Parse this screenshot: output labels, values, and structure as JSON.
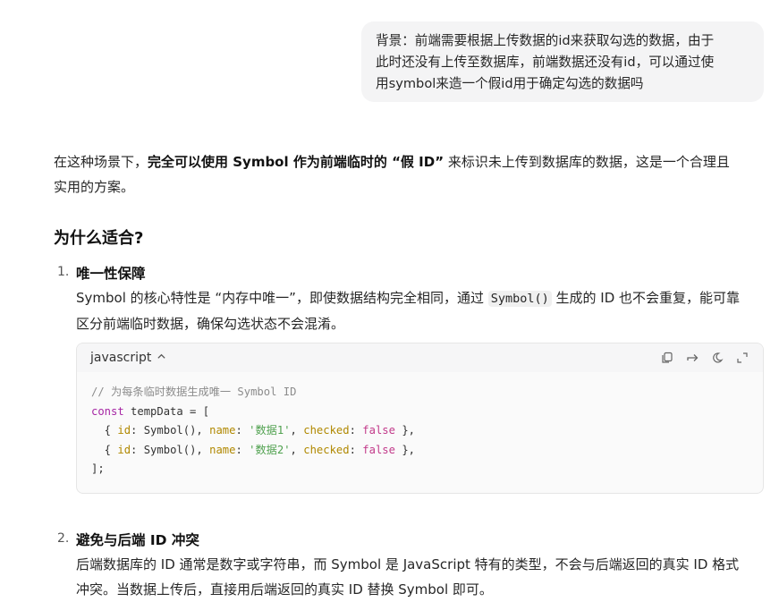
{
  "user_message": {
    "line1": "背景：前端需要根据上传数据的id来获取勾选的数据，由于",
    "line2": "此时还没有上传至数据库，前端数据还没有id，可以通过使",
    "line3": "用symbol来造一个假id用于确定勾选的数据吗"
  },
  "answer": {
    "intro_a": "在这种场景下，",
    "intro_b": "完全可以使用 Symbol 作为前端临时的 “假 ID”",
    "intro_c": " 来标识未上传到数据库的数据，这是一个合理且",
    "intro_d": "实用的方案。",
    "heading": "为什么适合?",
    "items": [
      {
        "num": "1.",
        "title": "唯一性保障",
        "body_a": "Symbol 的核心特性是 “内存中唯一”，即使数据结构完全相同，通过 ",
        "code": "Symbol()",
        "body_b": " 生成的 ID 也不会重复，能可靠",
        "body_c": "区分前端临时数据，确保勾选状态不会混淆。"
      },
      {
        "num": "2.",
        "title": "避免与后端 ID 冲突",
        "body_a": "后端数据库的 ID 通常是数字或字符串，而 Symbol 是 JavaScript 特有的类型，不会与后端返回的真实 ID 格式",
        "body_b": "冲突。当数据上传后，直接用后端返回的真实 ID 替换 Symbol 即可。"
      }
    ]
  },
  "code_block": {
    "language": "javascript",
    "line1": "// 为每条临时数据生成唯一 Symbol ID",
    "kw_const": "const",
    "var_decl": " tempData = [",
    "rows": [
      {
        "open": "  { ",
        "id_key": "id",
        "sep1": ": Symbol(), ",
        "name_key": "name",
        "sep2": ": ",
        "name_val": "'数据1'",
        "sep3": ", ",
        "checked_key": "checked",
        "sep4": ": ",
        "checked_val": "false",
        "close": " },"
      },
      {
        "open": "  { ",
        "id_key": "id",
        "sep1": ": Symbol(), ",
        "name_key": "name",
        "sep2": ": ",
        "name_val": "'数据2'",
        "sep3": ", ",
        "checked_key": "checked",
        "sep4": ": ",
        "checked_val": "false",
        "close": " },"
      }
    ],
    "last_line": "];"
  },
  "icons": [
    "chevron-up-icon",
    "copy-icon",
    "wrap-icon",
    "theme-icon",
    "expand-icon"
  ]
}
